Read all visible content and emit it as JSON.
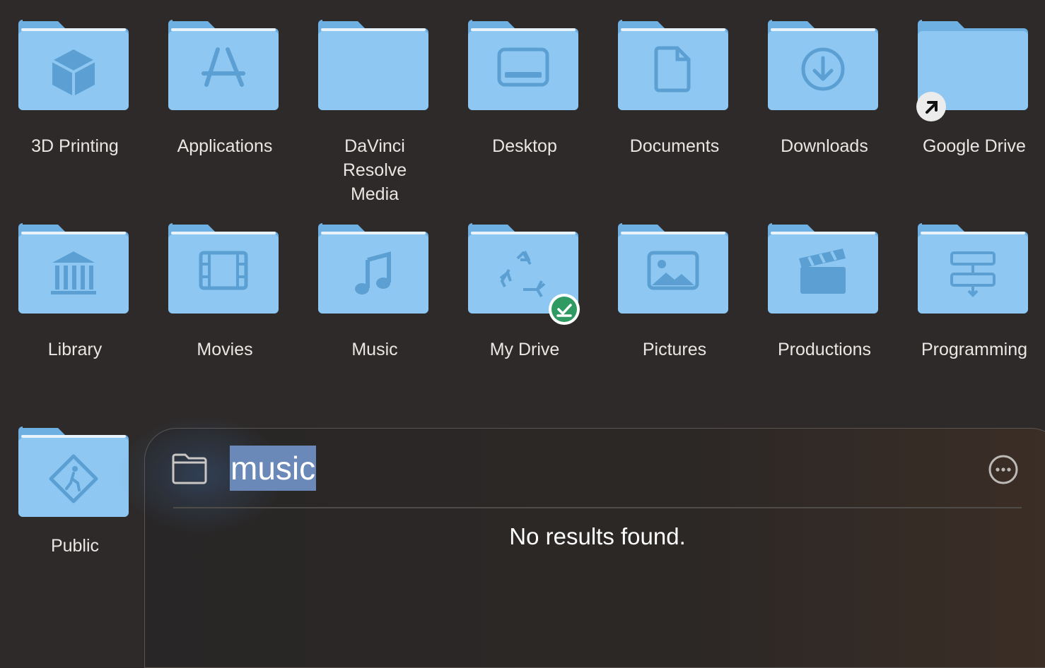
{
  "folders": [
    {
      "label": "3D Printing",
      "icon": "cube-icon"
    },
    {
      "label": "Applications",
      "icon": "app-store-icon"
    },
    {
      "label": "DaVinci Resolve Media",
      "icon": "none"
    },
    {
      "label": "Desktop",
      "icon": "desktop-icon"
    },
    {
      "label": "Documents",
      "icon": "document-icon"
    },
    {
      "label": "Downloads",
      "icon": "download-icon"
    },
    {
      "label": "Google Drive",
      "icon": "alias-arrow-icon"
    },
    {
      "label": "Library",
      "icon": "library-icon"
    },
    {
      "label": "Movies",
      "icon": "film-icon"
    },
    {
      "label": "Music",
      "icon": "music-note-icon"
    },
    {
      "label": "My Drive",
      "icon": "recycle-icon"
    },
    {
      "label": "Pictures",
      "icon": "picture-icon"
    },
    {
      "label": "Productions",
      "icon": "clapperboard-icon"
    },
    {
      "label": "Programming",
      "icon": "flowchart-icon"
    },
    {
      "label": "Public",
      "icon": "pedestrian-sign-icon"
    }
  ],
  "spotlight": {
    "query": "music",
    "empty_message": "No results found.",
    "folder_icon": "folder-outline-icon",
    "more_icon": "ellipsis-circle-icon"
  },
  "colors": {
    "background": "#2d2a29",
    "folder_body": "#8ec8f2",
    "folder_tab": "#6fb0e3",
    "glyph": "#5b9fd3",
    "selection": "#6a88b8",
    "synced_badge": "#2f9a62"
  }
}
